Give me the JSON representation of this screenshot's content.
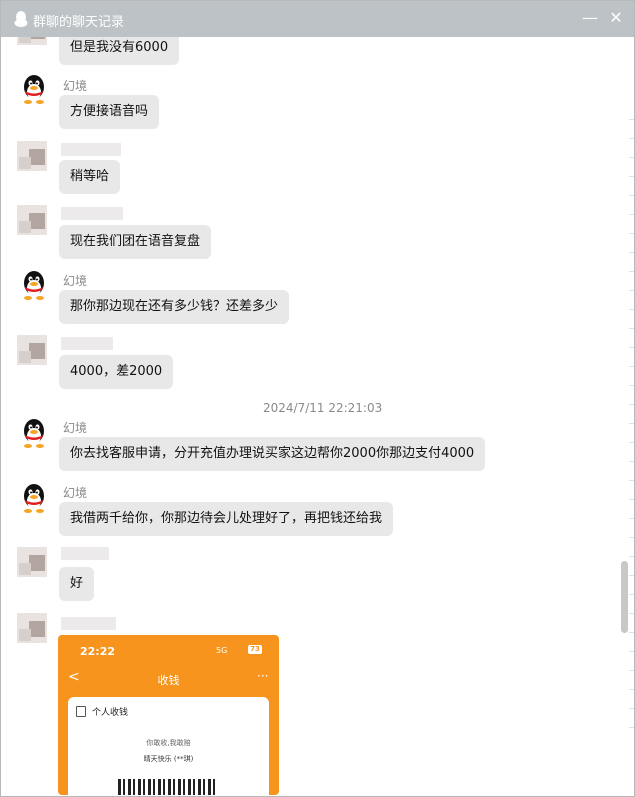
{
  "window": {
    "title": "群聊的聊天记录",
    "minimize_label": "—",
    "close_label": "✕"
  },
  "messages": [
    {
      "sender": "",
      "text": "但是我没有6000"
    },
    {
      "sender": "幻境",
      "text": "方便接语音吗"
    },
    {
      "sender": "",
      "text": "稍等哈"
    },
    {
      "sender": "",
      "text": "现在我们团在语音复盘"
    },
    {
      "sender": "幻境",
      "text": "那你那边现在还有多少钱？还差多少"
    },
    {
      "sender": "",
      "text": "4000，差2000"
    },
    {
      "sender": "幻境",
      "text": "你去找客服申请，分开充值办理说买家这边帮你2000你那边支付4000"
    },
    {
      "sender": "幻境",
      "text": "我借两千给你，你那边待会儿处理好了，再把钱还给我"
    },
    {
      "sender": "",
      "text": "好"
    }
  ],
  "timestamp": "2024/7/11 22:21:03",
  "phone_screenshot": {
    "time": "22:22",
    "signal": "5G",
    "battery": "73",
    "back": "<",
    "title": "收钱",
    "more": "···",
    "card_label": "个人收钱",
    "notice": "你敢收,我敢赔",
    "payee": "晴天快乐 (**琪)"
  }
}
